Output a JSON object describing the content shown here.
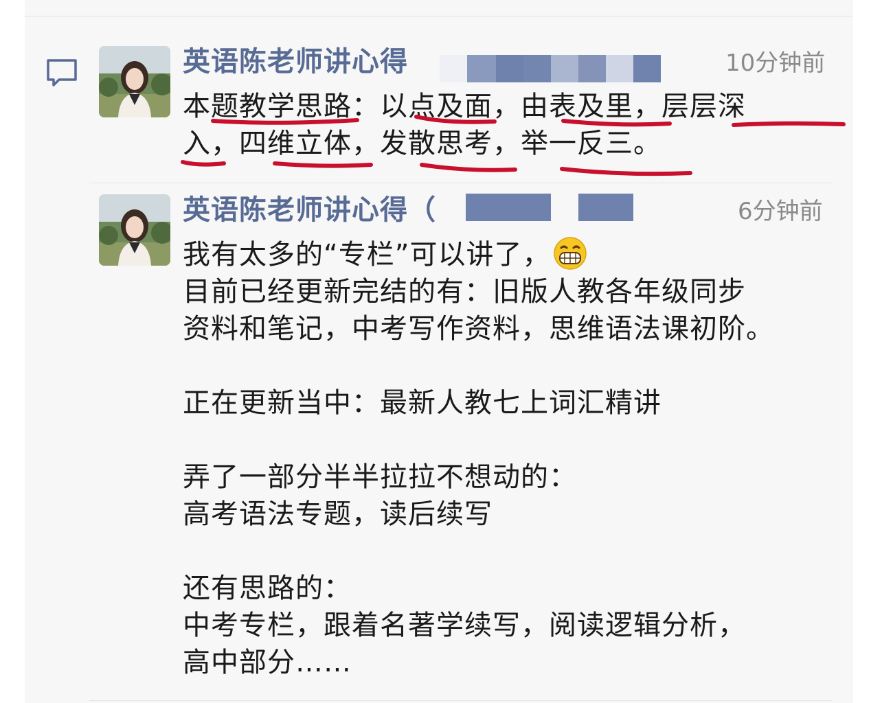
{
  "comments": [
    {
      "author": "英语陈老师讲心得",
      "time": "10分钟前",
      "lines": [
        "本题教学思路：以点及面，由表及里，层层深",
        "入，四维立体，发散思考，举一反三。"
      ]
    },
    {
      "author": "英语陈老师讲心得（",
      "time": "6分钟前",
      "lines": [
        "我有太多的“专栏”可以讲了，",
        "目前已经更新完结的有：旧版人教各年级同步",
        "资料和笔记，中考写作资料，思维语法课初阶。",
        "",
        "正在更新当中：最新人教七上词汇精讲",
        "",
        "弄了一部分半半拉拉不想动的：",
        "高考语法专题，读后续写",
        "",
        "还有思路的：",
        "中考专栏，跟着名著学续写，阅读逻辑分析，",
        "高中部分……"
      ],
      "emoji": "grinning-face-icon"
    }
  ],
  "colors": {
    "author": "#576b95",
    "underline": "#c8102e",
    "redact": "#6f82ad"
  }
}
